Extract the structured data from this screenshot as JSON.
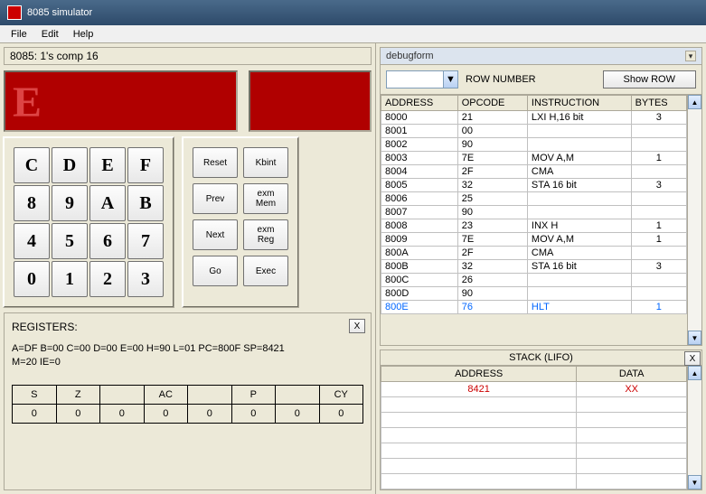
{
  "window": {
    "title": "8085 simulator"
  },
  "menu": [
    "File",
    "Edit",
    "Help"
  ],
  "subtitle": "8085: 1's comp 16",
  "display": {
    "big": "E",
    "small": ""
  },
  "keypad": [
    "C",
    "D",
    "E",
    "F",
    "8",
    "9",
    "A",
    "B",
    "4",
    "5",
    "6",
    "7",
    "0",
    "1",
    "2",
    "3"
  ],
  "controls": {
    "reset": "Reset",
    "kbint": "Kbint",
    "prev": "Prev",
    "exmmem": "exm\nMem",
    "next": "Next",
    "exmreg": "exm\nReg",
    "go": "Go",
    "exec": "Exec"
  },
  "registers": {
    "title": "REGISTERS:",
    "line1": "A=DF  B=00  C=00  D=00  E=00  H=90  L=01  PC=800F  SP=8421",
    "line2": "M=20  IE=0",
    "flags_h": [
      "S",
      "Z",
      "",
      "AC",
      "",
      "P",
      "",
      "CY"
    ],
    "flags_v": [
      "0",
      "0",
      "0",
      "0",
      "0",
      "0",
      "0",
      "0"
    ]
  },
  "debug": {
    "title": "debugform",
    "row_label": "ROW NUMBER",
    "show_btn": "Show ROW",
    "cols": [
      "ADDRESS",
      "OPCODE",
      "INSTRUCTION",
      "BYTES"
    ],
    "rows": [
      {
        "a": "8000",
        "o": "21",
        "i": "LXI H,16 bit",
        "b": "3"
      },
      {
        "a": "8001",
        "o": "00",
        "i": "",
        "b": ""
      },
      {
        "a": "8002",
        "o": "90",
        "i": "",
        "b": ""
      },
      {
        "a": "8003",
        "o": "7E",
        "i": "MOV A,M",
        "b": "1"
      },
      {
        "a": "8004",
        "o": "2F",
        "i": "CMA",
        "b": ""
      },
      {
        "a": "8005",
        "o": "32",
        "i": "STA 16 bit",
        "b": "3"
      },
      {
        "a": "8006",
        "o": "25",
        "i": "",
        "b": ""
      },
      {
        "a": "8007",
        "o": "90",
        "i": "",
        "b": ""
      },
      {
        "a": "8008",
        "o": "23",
        "i": "INX H",
        "b": "1"
      },
      {
        "a": "8009",
        "o": "7E",
        "i": "MOV A,M",
        "b": "1"
      },
      {
        "a": "800A",
        "o": "2F",
        "i": "CMA",
        "b": ""
      },
      {
        "a": "800B",
        "o": "32",
        "i": "STA 16 bit",
        "b": "3"
      },
      {
        "a": "800C",
        "o": "26",
        "i": "",
        "b": ""
      },
      {
        "a": "800D",
        "o": "90",
        "i": "",
        "b": ""
      },
      {
        "a": "800E",
        "o": "76",
        "i": "HLT",
        "b": "1",
        "hlt": true
      }
    ]
  },
  "stack": {
    "title": "STACK (LIFO)",
    "cols": [
      "ADDRESS",
      "DATA"
    ],
    "rows": [
      {
        "a": "8421",
        "d": "XX"
      }
    ]
  }
}
